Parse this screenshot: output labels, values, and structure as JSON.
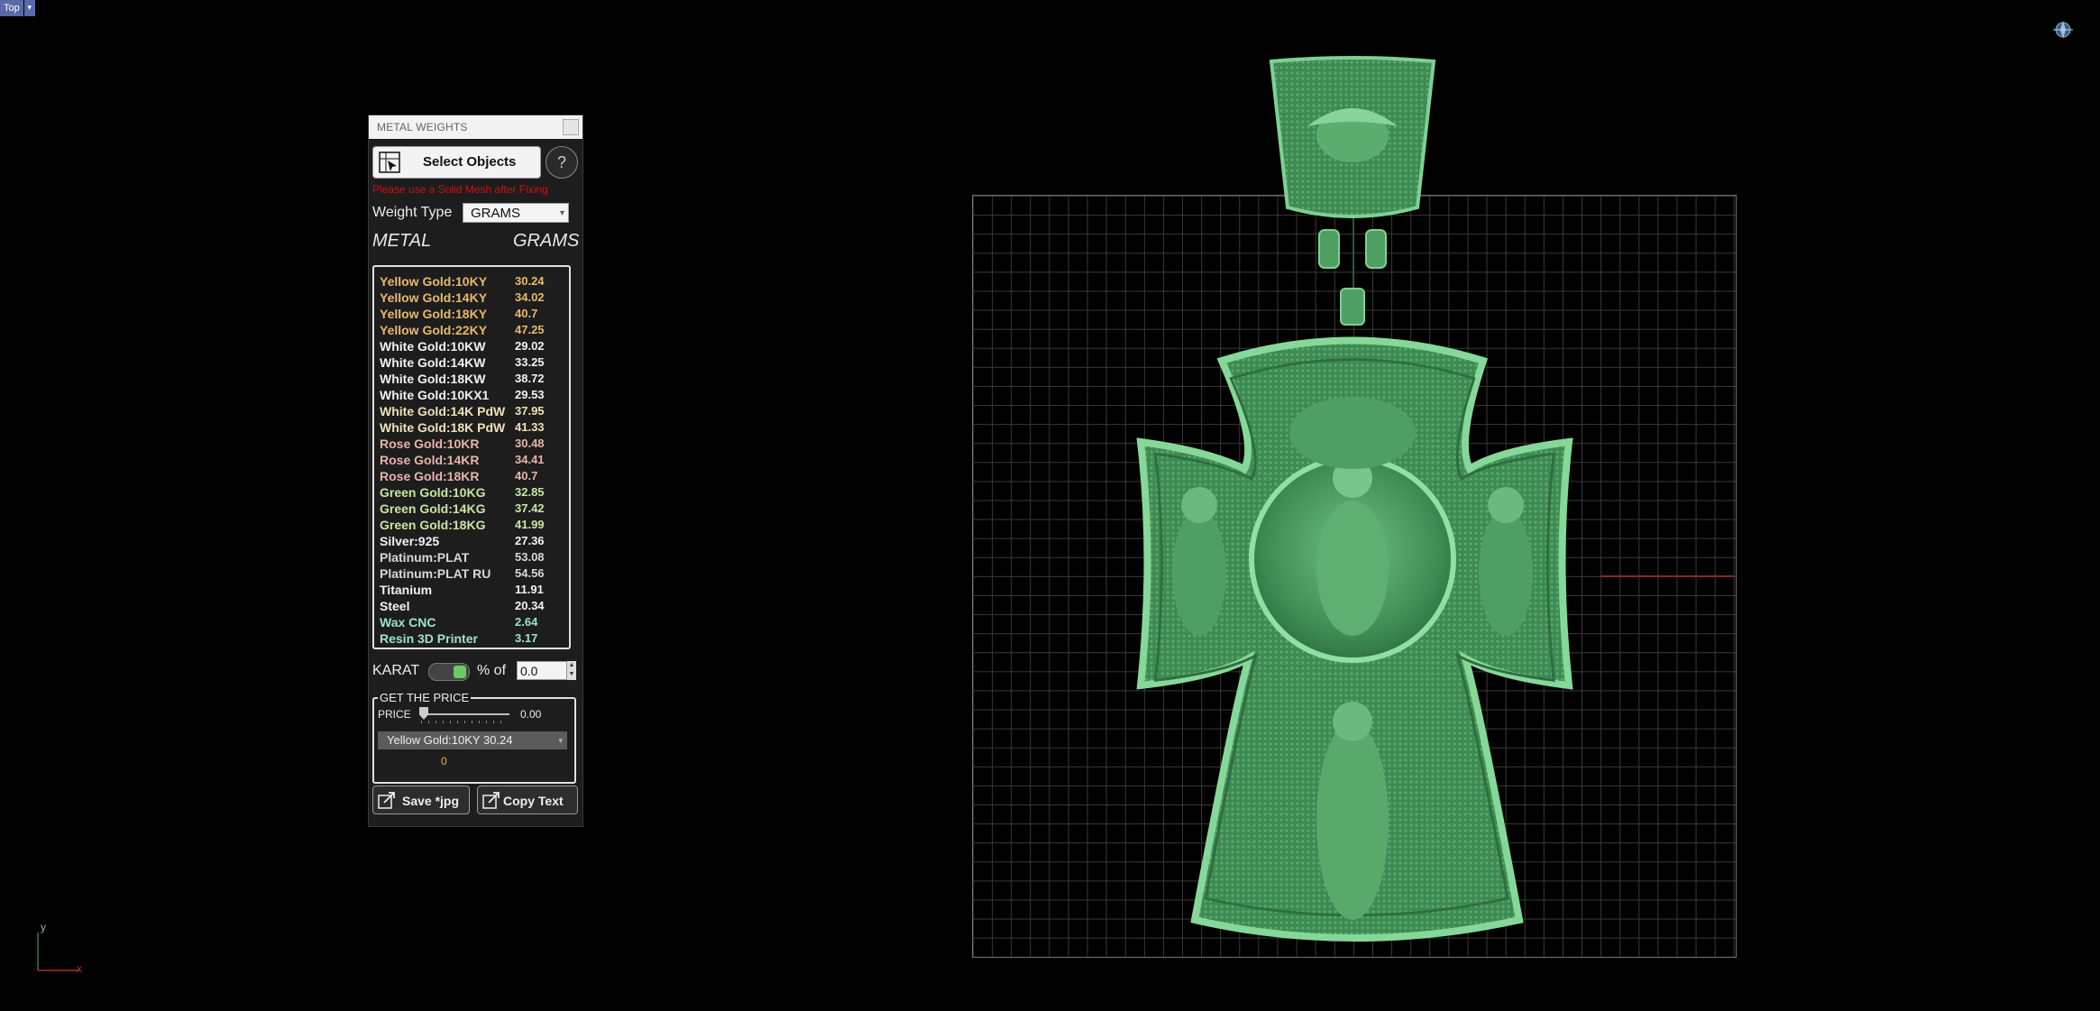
{
  "viewport": {
    "label": "Top",
    "label_arrow": "▾"
  },
  "panel": {
    "title": "METAL WEIGHTS",
    "select_button": "Select Objects",
    "help": "?",
    "warning": "Please use a Solid Mesh after Fixing",
    "weight_type_label": "Weight Type",
    "weight_type_value": "GRAMS",
    "col_metal": "METAL",
    "col_grams": "GRAMS",
    "metals": [
      {
        "name": "Yellow Gold:10KY",
        "grams": "30.24",
        "color": "#e8b86a"
      },
      {
        "name": "Yellow Gold:14KY",
        "grams": "34.02",
        "color": "#e8b86a"
      },
      {
        "name": "Yellow Gold:18KY",
        "grams": "40.7",
        "color": "#e8b86a"
      },
      {
        "name": "Yellow Gold:22KY",
        "grams": "47.25",
        "color": "#e8b86a"
      },
      {
        "name": "White Gold:10KW",
        "grams": "29.02",
        "color": "#f2f2f2"
      },
      {
        "name": "White Gold:14KW",
        "grams": "33.25",
        "color": "#f2f2f2"
      },
      {
        "name": "White Gold:18KW",
        "grams": "38.72",
        "color": "#f2f2f2"
      },
      {
        "name": "White Gold:10KX1",
        "grams": "29.53",
        "color": "#f2f2f2"
      },
      {
        "name": "White Gold:14K PdW",
        "grams": "37.95",
        "color": "#efe2b8"
      },
      {
        "name": "White Gold:18K PdW",
        "grams": "41.33",
        "color": "#efe2b8"
      },
      {
        "name": "Rose Gold:10KR",
        "grams": "30.48",
        "color": "#e8b3a8"
      },
      {
        "name": "Rose Gold:14KR",
        "grams": "34.41",
        "color": "#e8b3a8"
      },
      {
        "name": "Rose Gold:18KR",
        "grams": "40.7",
        "color": "#e8b3a8"
      },
      {
        "name": "Green Gold:10KG",
        "grams": "32.85",
        "color": "#c7e6a4"
      },
      {
        "name": "Green Gold:14KG",
        "grams": "37.42",
        "color": "#c7e6a4"
      },
      {
        "name": "Green Gold:18KG",
        "grams": "41.99",
        "color": "#c7e6a4"
      },
      {
        "name": "Silver:925",
        "grams": "27.36",
        "color": "#f2f2f2"
      },
      {
        "name": "Platinum:PLAT",
        "grams": "53.08",
        "color": "#d8d8d8"
      },
      {
        "name": "Platinum:PLAT RU",
        "grams": "54.56",
        "color": "#d8d8d8"
      },
      {
        "name": "Titanium",
        "grams": "11.91",
        "color": "#f2f2f2"
      },
      {
        "name": "Steel",
        "grams": "20.34",
        "color": "#f2f2f2"
      },
      {
        "name": "Wax  CNC",
        "grams": "2.64",
        "color": "#9fe0d0"
      },
      {
        "name": "Resin 3D Printer",
        "grams": "3.17",
        "color": "#9fe0d0"
      }
    ],
    "karat_label": "KARAT",
    "pct_of": "% of",
    "karat_value": "0.0",
    "price_section": "GET THE PRICE",
    "price_label": "PRICE",
    "price_value": "0.00",
    "price_metal": "Yellow Gold:10KY 30.24",
    "price_result": "0",
    "save_button": "Save *jpg",
    "copy_button": "Copy  Text"
  },
  "axes": {
    "x": "x",
    "y": "y"
  }
}
